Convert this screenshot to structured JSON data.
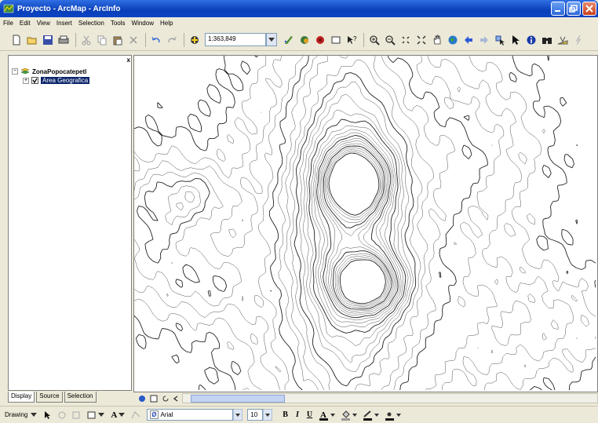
{
  "window": {
    "title": "Proyecto - ArcMap - ArcInfo"
  },
  "menu": [
    {
      "label": "File"
    },
    {
      "label": "Edit"
    },
    {
      "label": "View"
    },
    {
      "label": "Insert"
    },
    {
      "label": "Selection"
    },
    {
      "label": "Tools"
    },
    {
      "label": "Window"
    },
    {
      "label": "Help"
    }
  ],
  "toolbar": {
    "scale_value": "1:363,849",
    "icons": [
      "new-document-icon",
      "open-folder-icon",
      "save-icon",
      "print-icon",
      "cut-icon",
      "copy-icon",
      "paste-icon",
      "delete-icon",
      "undo-icon",
      "redo-icon",
      "add-data-icon"
    ]
  },
  "toc": {
    "data_frame": "ZonaPopocatepetl",
    "layer": "Area Geografica",
    "close_glyph": "x",
    "tabs": [
      {
        "label": "Display"
      },
      {
        "label": "Source"
      },
      {
        "label": "Selection"
      }
    ]
  },
  "drawing": {
    "menu_label": "Drawing",
    "font_name": "Arial",
    "font_size": "10",
    "text_tool": "A",
    "bold": "B",
    "italic": "I",
    "underline": "U"
  },
  "colors": {
    "titlebar": "#0a3fb8",
    "selection": "#0a246a",
    "chrome": "#ece9d8"
  }
}
